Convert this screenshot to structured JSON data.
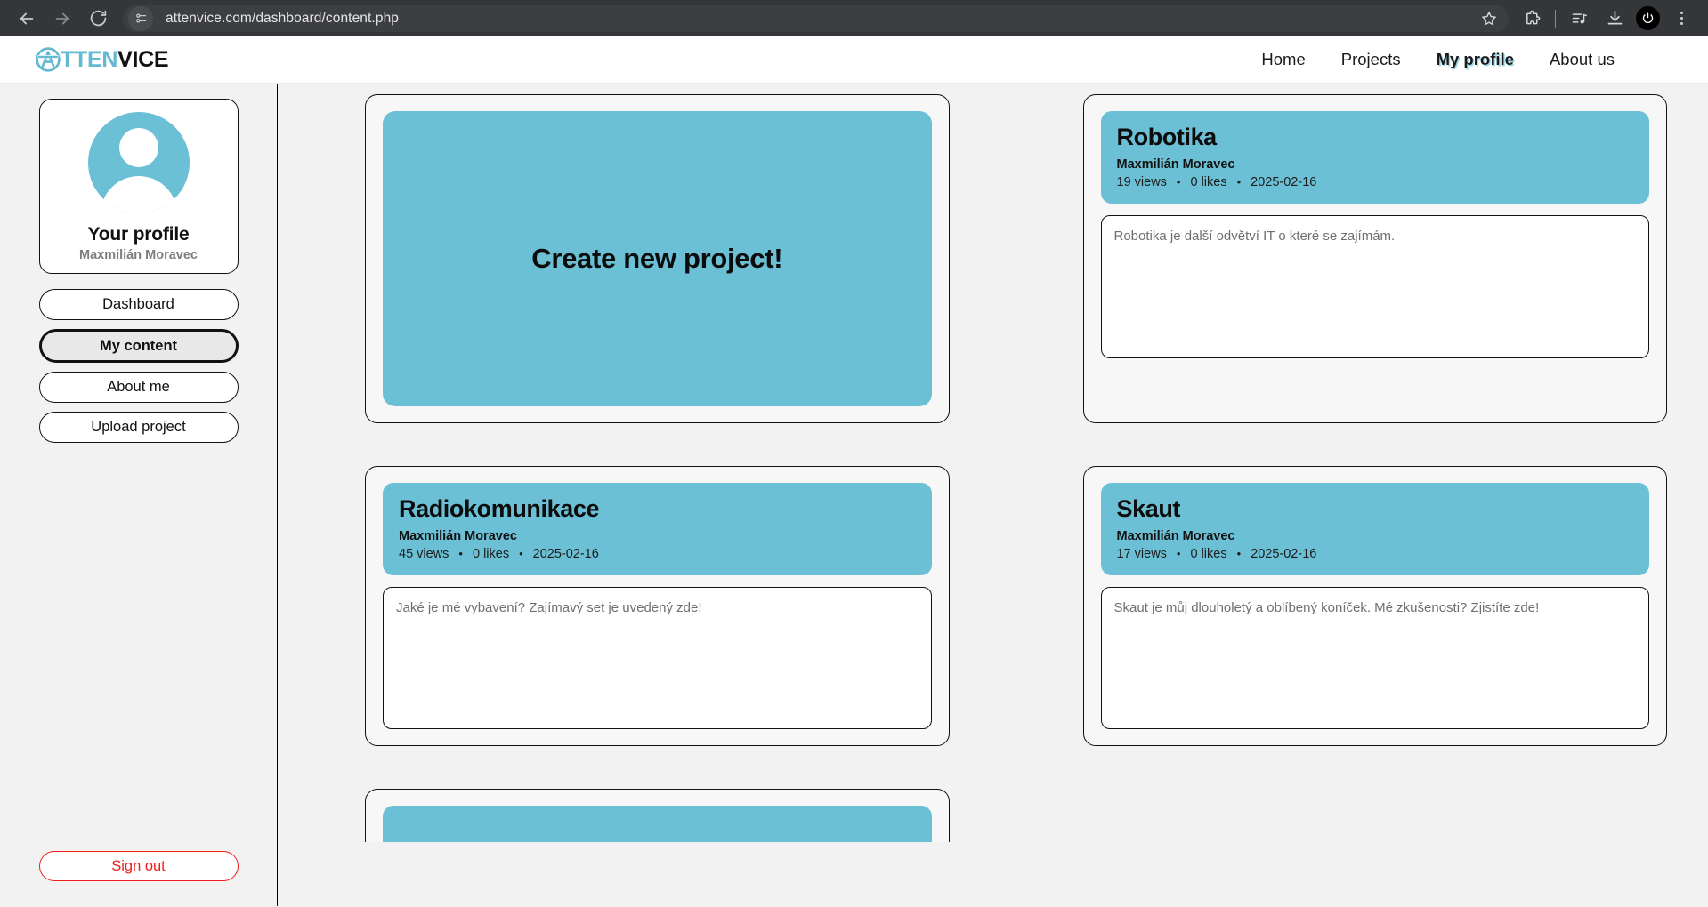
{
  "browser": {
    "url": "attenvice.com/dashboard/content.php",
    "back_icon": "back-arrow-icon",
    "forward_icon": "forward-arrow-icon",
    "reload_icon": "reload-icon",
    "site_info_icon": "site-info-icon",
    "bookmark_icon": "star-icon",
    "extensions_icon": "extensions-puzzle-icon",
    "media_icon": "media-playlist-icon",
    "downloads_icon": "download-icon",
    "profile_icon": "profile-power-icon",
    "menu_icon": "kebab-menu-icon"
  },
  "header": {
    "logo": {
      "mark": "attenvice-a-emblem-icon",
      "blue_part": "TTEN",
      "dark_part": "VICE"
    },
    "nav": [
      {
        "label": "Home",
        "active": false
      },
      {
        "label": "Projects",
        "active": false
      },
      {
        "label": "My profile",
        "active": true
      },
      {
        "label": "About us",
        "active": false
      }
    ]
  },
  "sidebar": {
    "avatar_icon": "user-avatar-icon",
    "profile_title": "Your profile",
    "profile_name": "Maxmilián Moravec",
    "buttons": [
      {
        "label": "Dashboard",
        "active": false
      },
      {
        "label": "My content",
        "active": true
      },
      {
        "label": "About me",
        "active": false
      },
      {
        "label": "Upload project",
        "active": false
      }
    ],
    "sign_out": "Sign out"
  },
  "main": {
    "create_card": {
      "label": "Create new project!"
    },
    "projects": [
      {
        "title": "Robotika",
        "author": "Maxmilián Moravec",
        "views": "19 views",
        "likes": "0 likes",
        "date": "2025-02-16",
        "description": "Robotika je další odvětví IT o které se zajímám."
      },
      {
        "title": "Radiokomunikace",
        "author": "Maxmilián Moravec",
        "views": "45 views",
        "likes": "0 likes",
        "date": "2025-02-16",
        "description": "Jaké je mé vybavení? Zajímavý set je uvedený zde!"
      },
      {
        "title": "Skaut",
        "author": "Maxmilián Moravec",
        "views": "17 views",
        "likes": "0 likes",
        "date": "2025-02-16",
        "description": "Skaut je můj dlouholetý a oblíbený koníček. Mé zkušenosti? Zjistíte zde!"
      }
    ],
    "separator": "•"
  },
  "colors": {
    "accent": "#6bc0d5",
    "page_bg": "#f2f2f2",
    "danger": "#ef1c1c",
    "chrome_bg": "#35363a"
  }
}
